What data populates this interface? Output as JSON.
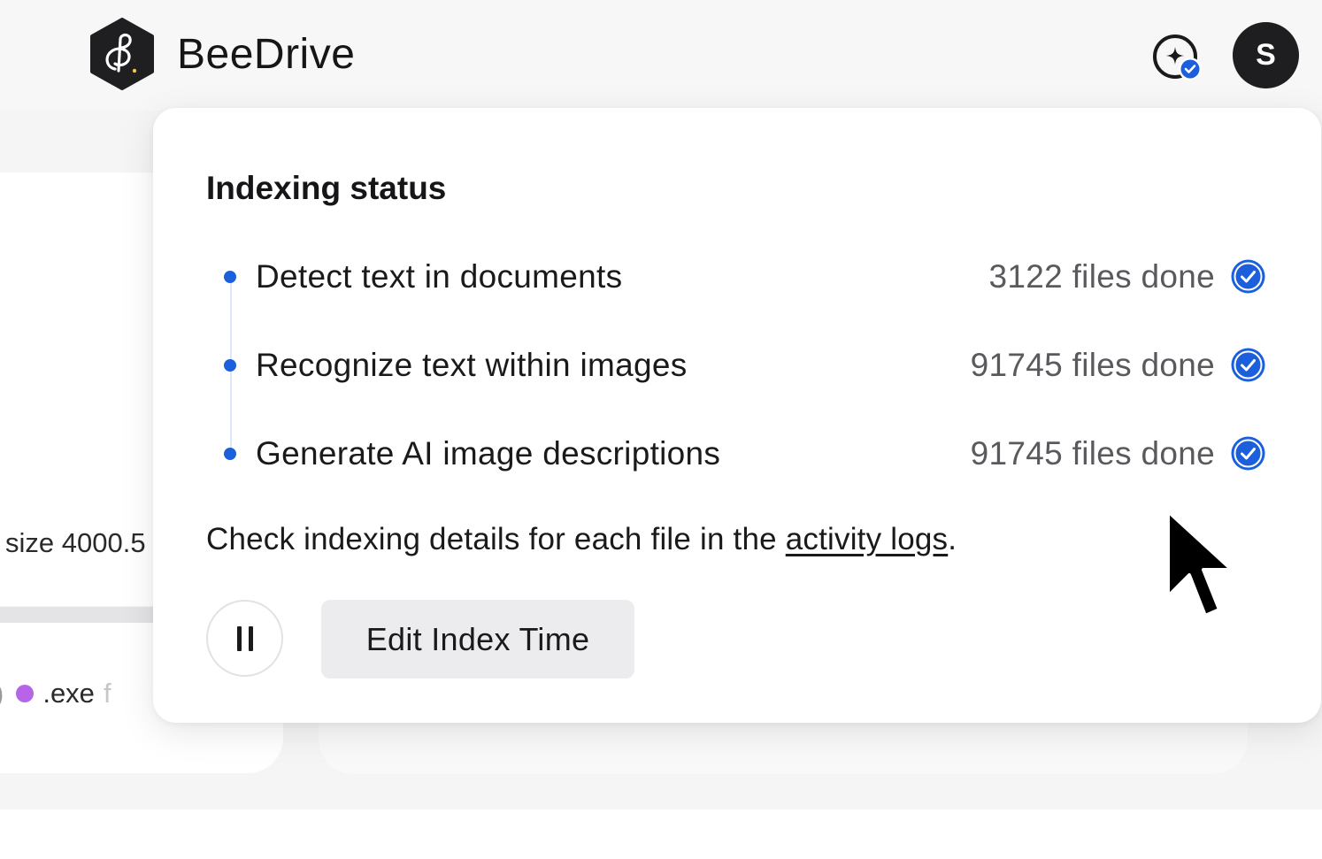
{
  "app": {
    "title": "BeeDrive"
  },
  "header": {
    "ai_status_icon": "sparkle-check-icon",
    "avatar_initial": "S"
  },
  "background": {
    "size_text": "size 4000.5",
    "filetype_edge": ")",
    "filetype_label": ".exe",
    "filetype_trailing": "f",
    "filetype_color": "#b665e8"
  },
  "popover": {
    "title": "Indexing status",
    "tasks": [
      {
        "label": "Detect text in documents",
        "count": "3122 files done",
        "status": "done"
      },
      {
        "label": "Recognize text within images",
        "count": "91745 files done",
        "status": "done"
      },
      {
        "label": "Generate AI image descriptions",
        "count": "91745 files done",
        "status": "done"
      }
    ],
    "help_prefix": "Check indexing details for each file in the ",
    "help_link": "activity logs",
    "help_suffix": ".",
    "pause_label": "",
    "edit_button_label": "Edit Index Time"
  },
  "colors": {
    "accent": "#1b5fdc",
    "avatar_bg": "#1e1e20"
  }
}
